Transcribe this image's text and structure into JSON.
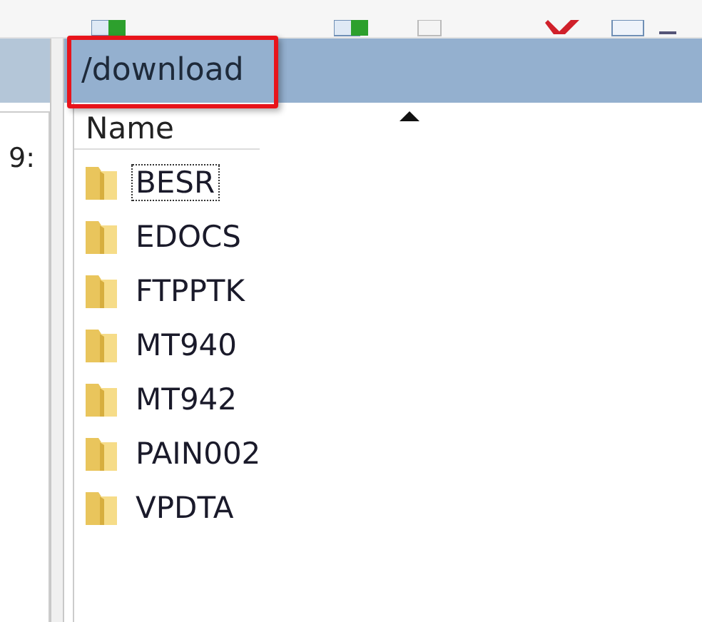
{
  "left_pane": {
    "cell_text": "9:"
  },
  "right_pane": {
    "path": "/download",
    "path_highlighted": true,
    "column": {
      "label": "Name",
      "sorted_ascending": true
    },
    "folders": [
      {
        "name": "BESR",
        "selected": true
      },
      {
        "name": "EDOCS",
        "selected": false
      },
      {
        "name": "FTPPTK",
        "selected": false
      },
      {
        "name": "MT940",
        "selected": false
      },
      {
        "name": "MT942",
        "selected": false
      },
      {
        "name": "PAIN002",
        "selected": false
      },
      {
        "name": "VPDTA",
        "selected": false
      }
    ]
  }
}
